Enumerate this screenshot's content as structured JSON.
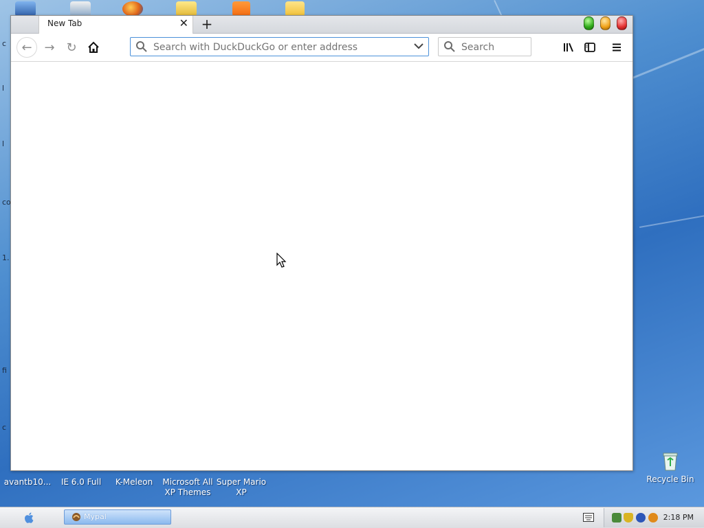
{
  "desktop": {
    "left_peek_letters": [
      "c",
      "l",
      "l",
      "co",
      "1.",
      "fi",
      "c"
    ],
    "icons": [
      {
        "label": "avantb10..."
      },
      {
        "label": "IE 6.0 Full"
      },
      {
        "label": "K-Meleon"
      },
      {
        "label": "Microsoft All XP Themes"
      },
      {
        "label": "Super Mario XP"
      }
    ],
    "recycle_bin": {
      "label": "Recycle Bin"
    }
  },
  "browser": {
    "tab": {
      "title": "New Tab"
    },
    "window_controls": [
      "maximize",
      "minimize",
      "close"
    ],
    "url_bar": {
      "value": "",
      "placeholder": "Search with DuckDuckGo or enter address"
    },
    "search_box": {
      "value": "",
      "placeholder": "Search"
    },
    "icons": {
      "back": "back-arrow-icon",
      "forward": "forward-arrow-icon",
      "reload": "reload-icon",
      "home": "home-icon",
      "library": "library-icon",
      "sidebar": "sidebar-icon",
      "menu": "hamburger-menu-icon"
    }
  },
  "taskbar": {
    "task_button": {
      "label": "Mypal"
    },
    "clock": "2:18 PM"
  },
  "colors": {
    "accent": "#4a90d9",
    "wallpaper": "#3f7fcb",
    "light_green": "#2faa1a",
    "light_amber": "#f1a219",
    "light_red": "#e43232"
  }
}
